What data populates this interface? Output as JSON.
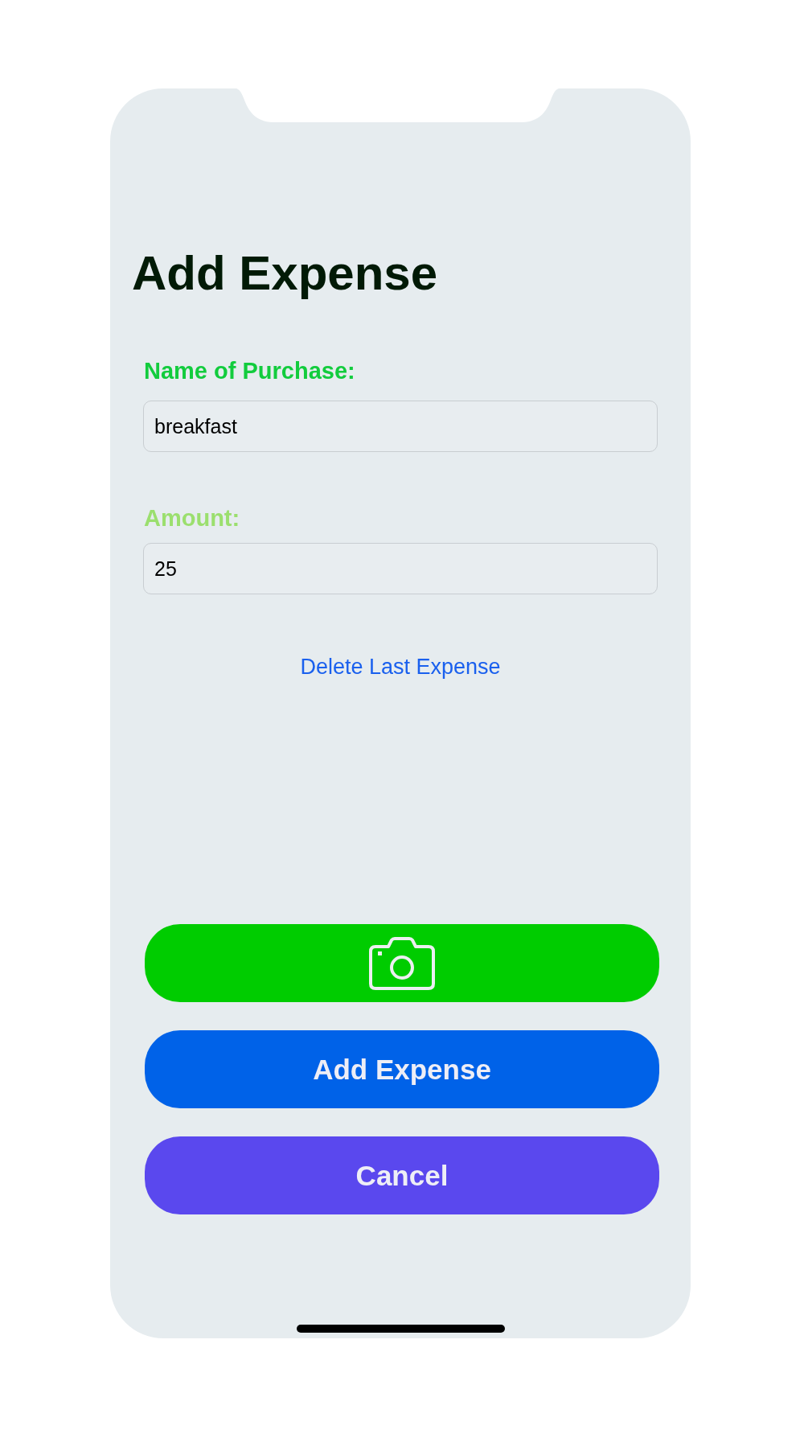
{
  "screen": {
    "title": "Add Expense"
  },
  "form": {
    "fields": [
      {
        "label": "Name of Purchase:",
        "color": "#12cc3d",
        "value": "breakfast"
      },
      {
        "label": "Amount:",
        "color": "#9bdf6e",
        "value": "25"
      }
    ]
  },
  "link": {
    "label": "Delete Last Expense"
  },
  "buttons": [
    {
      "kind": "icon",
      "color": "#00cc00"
    },
    {
      "kind": "text",
      "label": "Add Expense",
      "color": "#0062e8"
    },
    {
      "kind": "text",
      "label": "Cancel",
      "color": "#5a48ee"
    }
  ]
}
